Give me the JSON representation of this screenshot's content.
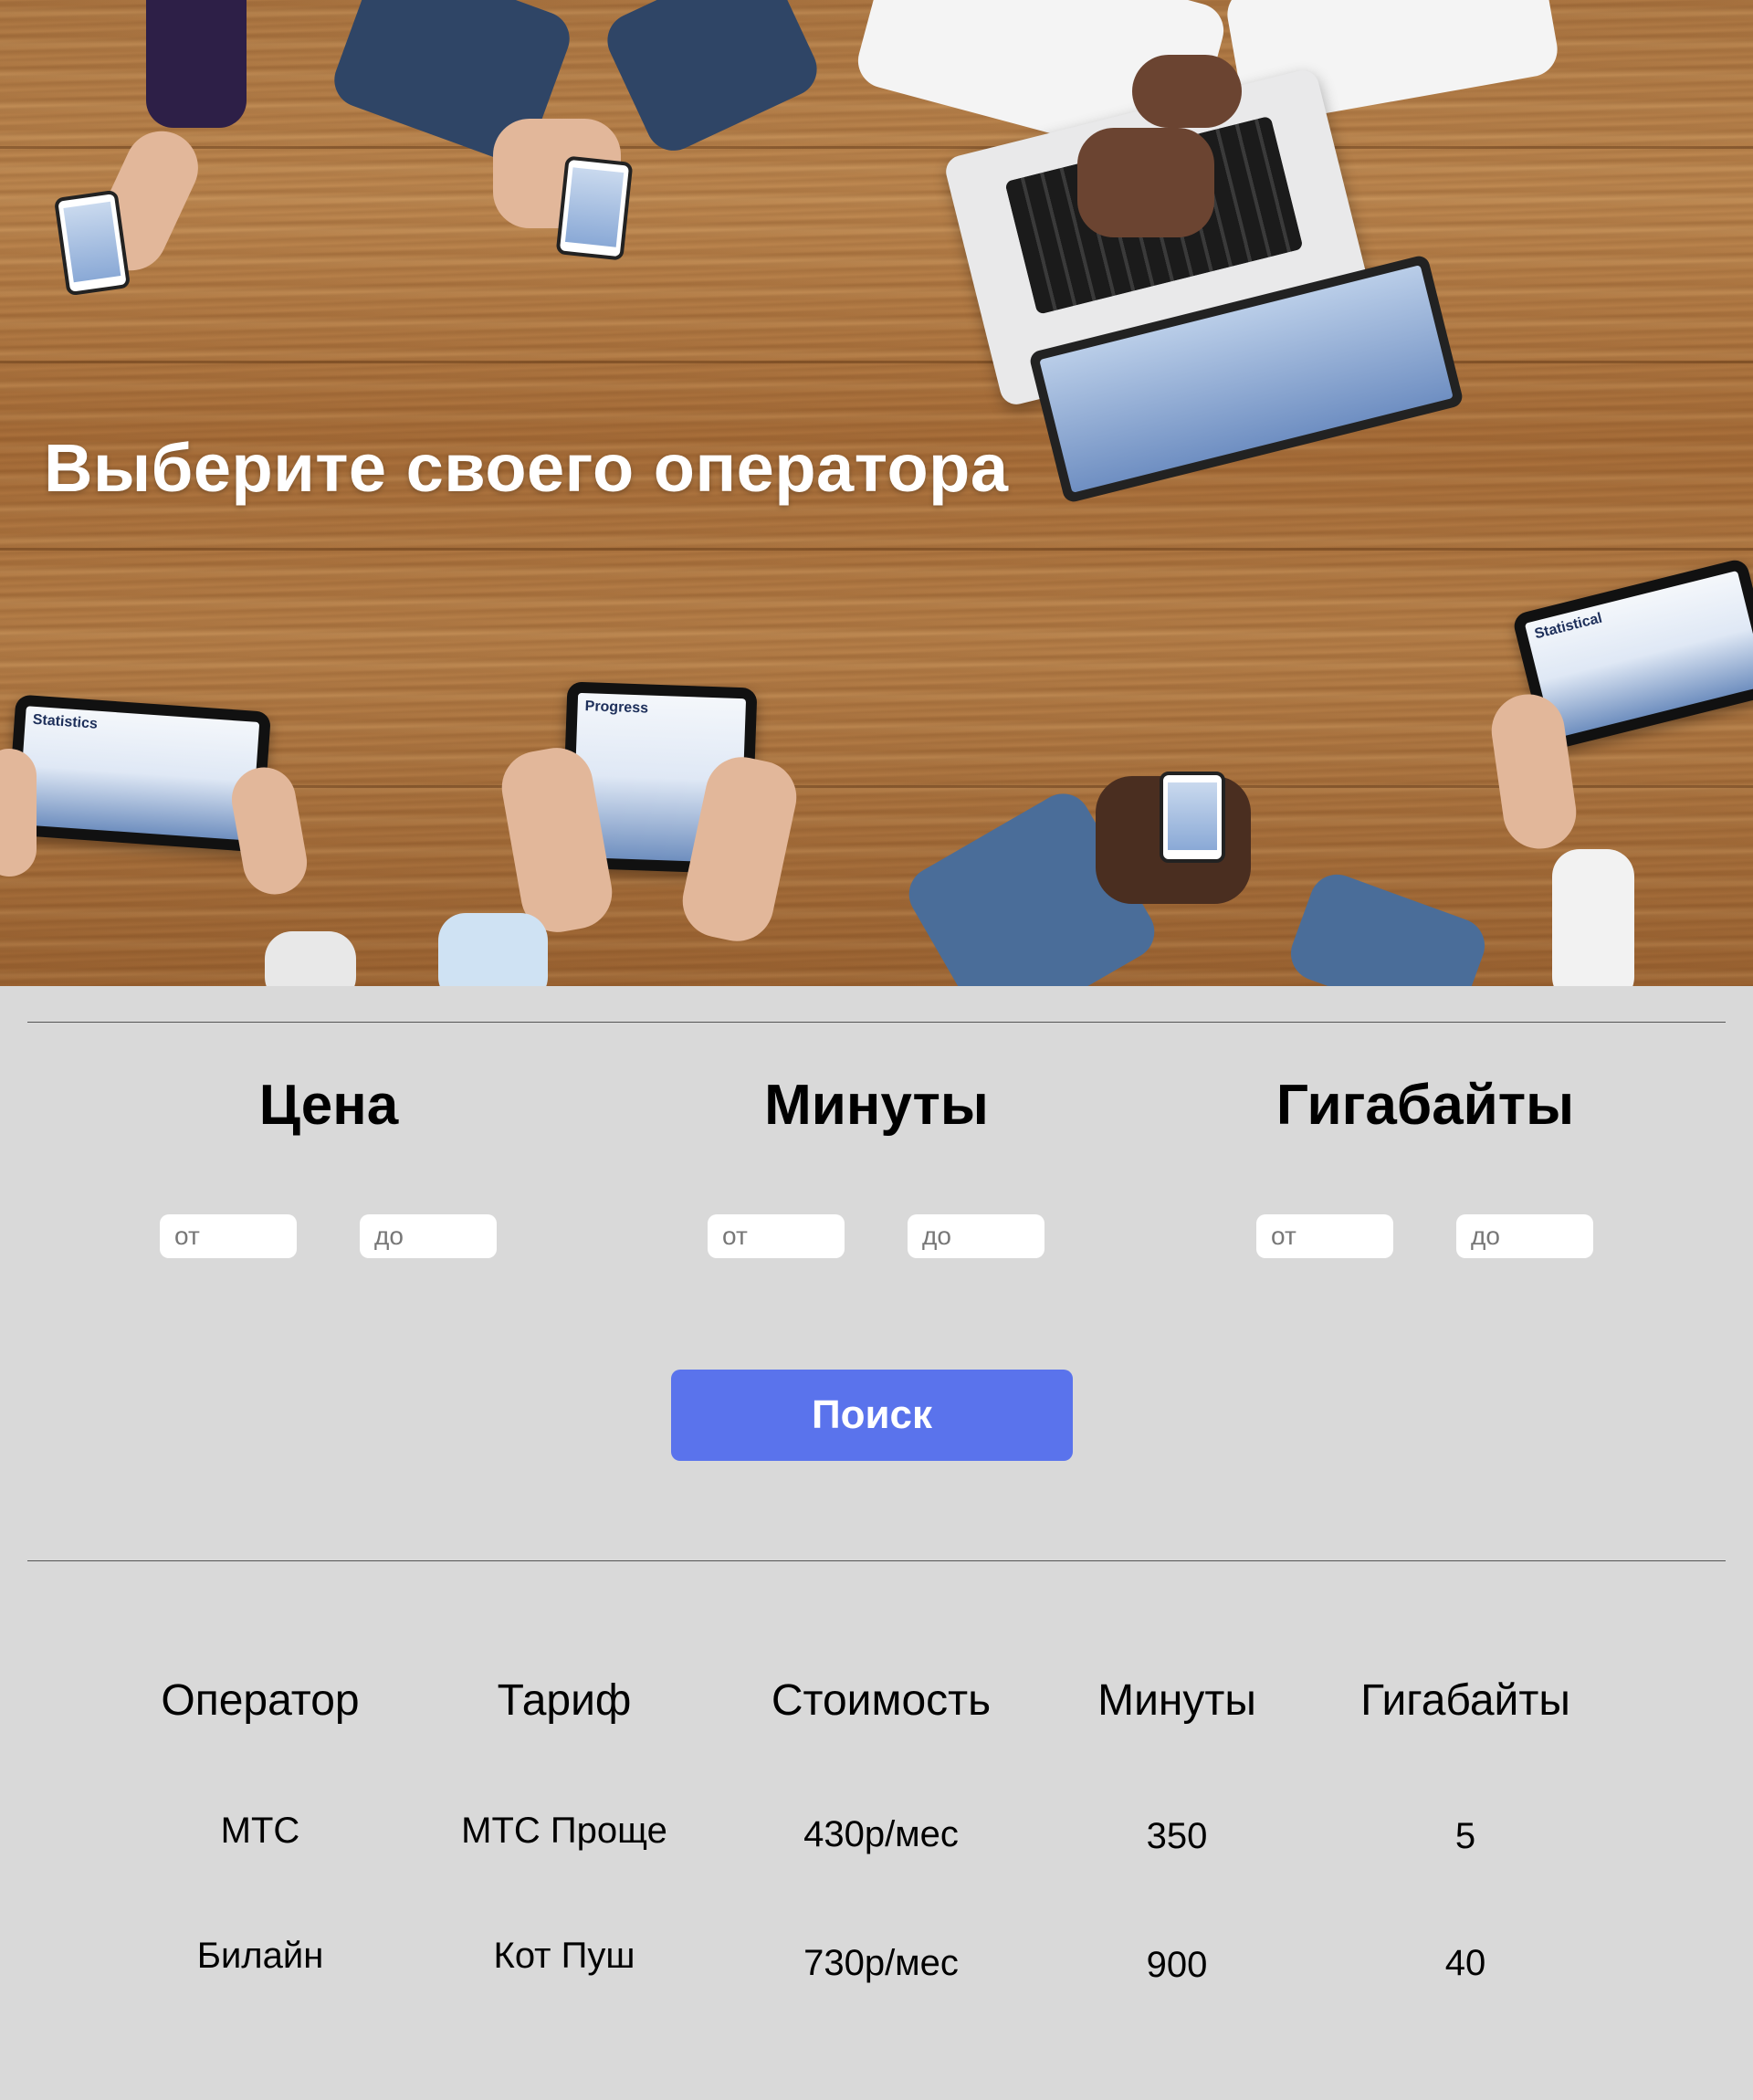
{
  "hero": {
    "title": "Выберите своего оператора",
    "device_labels": {
      "left_tablet": "Statistics",
      "center_tablet": "Progress",
      "right_tablet": "Statistical"
    }
  },
  "filters": [
    {
      "title": "Цена",
      "from_placeholder": "от",
      "to_placeholder": "до"
    },
    {
      "title": "Минуты",
      "from_placeholder": "от",
      "to_placeholder": "до"
    },
    {
      "title": "Гигабайты",
      "from_placeholder": "от",
      "to_placeholder": "до"
    }
  ],
  "search": {
    "button_label": "Поиск",
    "button_color": "#5a73ec"
  },
  "table": {
    "headers": [
      "Оператор",
      "Тариф",
      "Стоимость",
      "Минуты",
      "Гигабайты"
    ],
    "rows": [
      [
        "МТС",
        "МТС Проще",
        "430р/мес",
        "350",
        "5"
      ],
      [
        "Билайн",
        "Кот Пуш",
        "730р/мес",
        "900",
        "40"
      ]
    ]
  }
}
